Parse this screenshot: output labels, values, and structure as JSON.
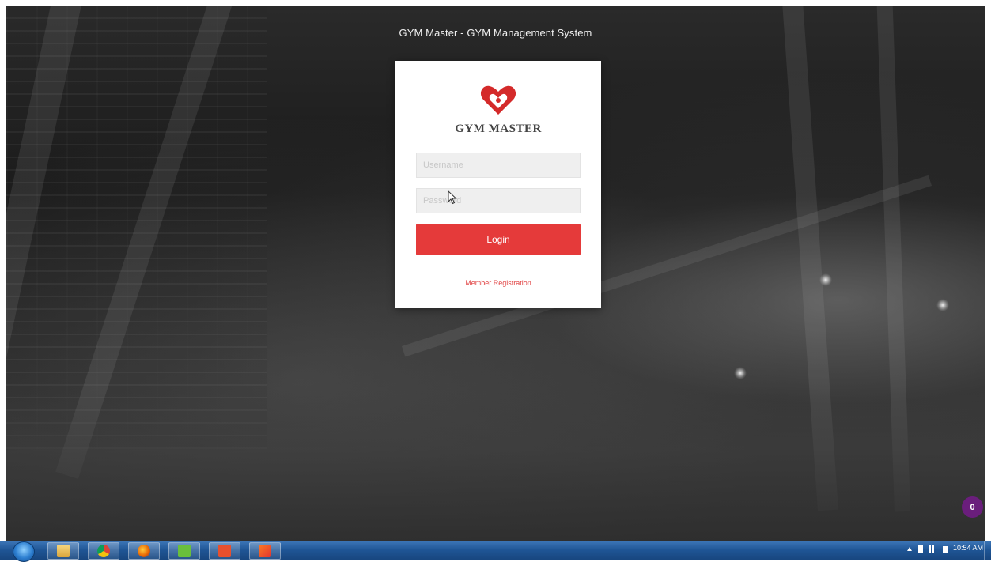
{
  "page": {
    "title": "GYM Master - GYM Management System"
  },
  "login": {
    "logo_text": "GYM MASTER",
    "username_placeholder": "Username",
    "password_placeholder": "Password",
    "login_label": "Login",
    "register_label": "Member Registration"
  },
  "chat_widget": {
    "count": "0"
  },
  "taskbar": {
    "apps": [
      {
        "name": "file-explorer-icon"
      },
      {
        "name": "chrome-icon"
      },
      {
        "name": "firefox-icon"
      },
      {
        "name": "utorrent-icon"
      },
      {
        "name": "document-icon"
      },
      {
        "name": "xampp-icon"
      }
    ],
    "clock_time": "10:54 AM"
  },
  "colors": {
    "accent": "#e53a3a",
    "link": "#e14444",
    "chat_badge": "#6a1e7c",
    "taskbar": "#1f5595"
  }
}
